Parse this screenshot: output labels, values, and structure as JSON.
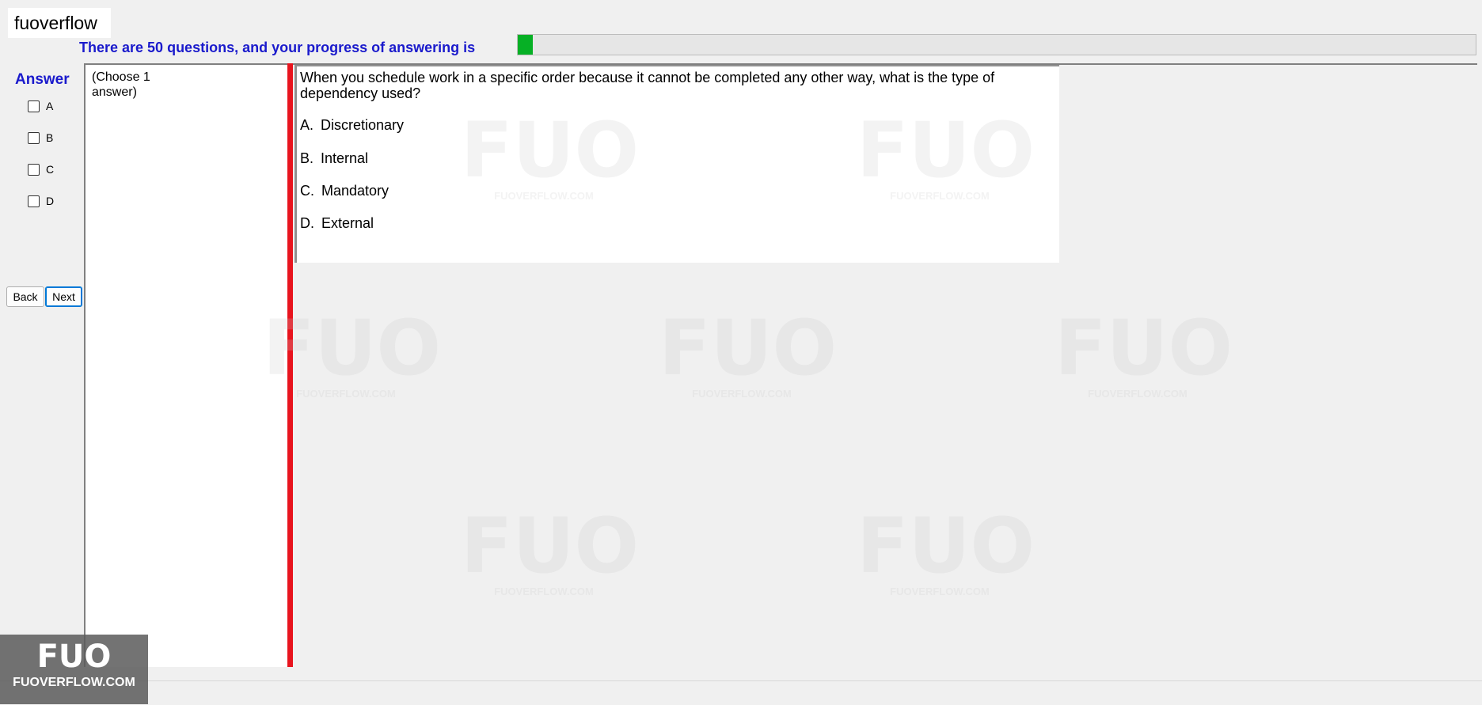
{
  "app_label": "fuoverflow",
  "progress": {
    "text": "There are 50 questions, and your progress of answering is",
    "fraction": 0.016,
    "fill_color": "#06b025"
  },
  "answer_panel": {
    "heading": "Answer",
    "options": [
      {
        "letter": "A",
        "checked": false
      },
      {
        "letter": "B",
        "checked": false
      },
      {
        "letter": "C",
        "checked": false
      },
      {
        "letter": "D",
        "checked": false
      }
    ],
    "back_label": "Back",
    "next_label": "Next"
  },
  "instruction": "(Choose 1 answer)",
  "question": {
    "text": "When you schedule work in a specific order because it cannot be completed any other way, what is the type of dependency used?",
    "choices": [
      {
        "letter": "A.",
        "text": "Discretionary"
      },
      {
        "letter": "B.",
        "text": "Internal"
      },
      {
        "letter": "C.",
        "text": "Mandatory"
      },
      {
        "letter": "D.",
        "text": "External"
      }
    ]
  },
  "logo": {
    "mark": "FUO",
    "text": "FUOVERFLOW.COM"
  },
  "watermark": {
    "mark": "FUO",
    "text": "FUOVERFLOW.COM"
  },
  "colors": {
    "accent_text": "#1a1acc",
    "divider": "#e8141e"
  }
}
